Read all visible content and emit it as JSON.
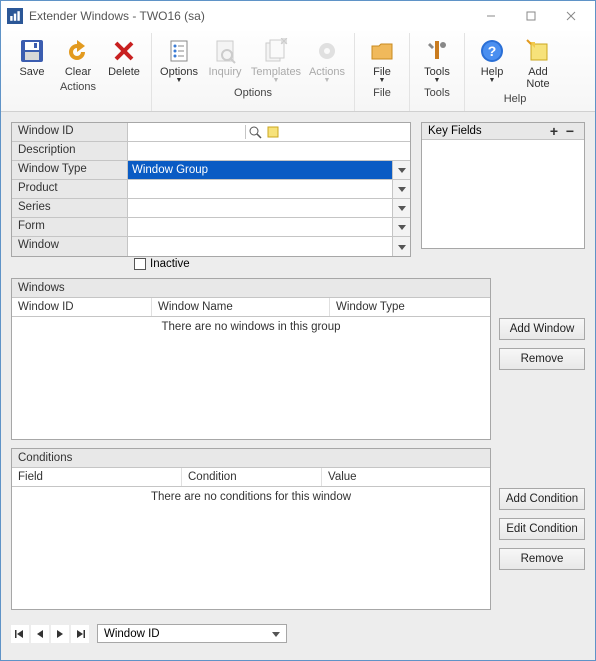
{
  "titlebar": {
    "text": "Extender Windows  -  TWO16 (sa)"
  },
  "ribbon": {
    "groups": [
      {
        "label": "Actions",
        "items": [
          {
            "label": "Save"
          },
          {
            "label": "Clear"
          },
          {
            "label": "Delete"
          }
        ]
      },
      {
        "label": "Options",
        "items": [
          {
            "label": "Options",
            "dd": true
          },
          {
            "label": "Inquiry",
            "disabled": true
          },
          {
            "label": "Templates",
            "disabled": true,
            "dd": true
          },
          {
            "label": "Actions",
            "disabled": true,
            "dd": true
          }
        ]
      },
      {
        "label": "File",
        "items": [
          {
            "label": "File",
            "dd": true
          }
        ]
      },
      {
        "label": "Tools",
        "items": [
          {
            "label": "Tools",
            "dd": true
          }
        ]
      },
      {
        "label": "Help",
        "items": [
          {
            "label": "Help",
            "dd": true
          },
          {
            "label": "Add Note",
            "twoLine": [
              "Add",
              "Note"
            ]
          }
        ]
      }
    ]
  },
  "form": {
    "labels": {
      "windowId": "Window ID",
      "description": "Description",
      "windowType": "Window Type",
      "product": "Product",
      "series": "Series",
      "formf": "Form",
      "window": "Window"
    },
    "values": {
      "windowType": "Window Group"
    },
    "inactive": "Inactive"
  },
  "keyFields": {
    "header": "Key Fields"
  },
  "windowsPanel": {
    "header": "Windows",
    "cols": {
      "id": "Window ID",
      "name": "Window Name",
      "type": "Window Type"
    },
    "empty": "There are no windows in this group",
    "buttons": {
      "add": "Add Window",
      "remove": "Remove"
    }
  },
  "conditionsPanel": {
    "header": "Conditions",
    "cols": {
      "field": "Field",
      "condition": "Condition",
      "value": "Value"
    },
    "empty": "There are no conditions for this window",
    "buttons": {
      "add": "Add Condition",
      "edit": "Edit Condition",
      "remove": "Remove"
    }
  },
  "nav": {
    "field": "Window ID"
  }
}
